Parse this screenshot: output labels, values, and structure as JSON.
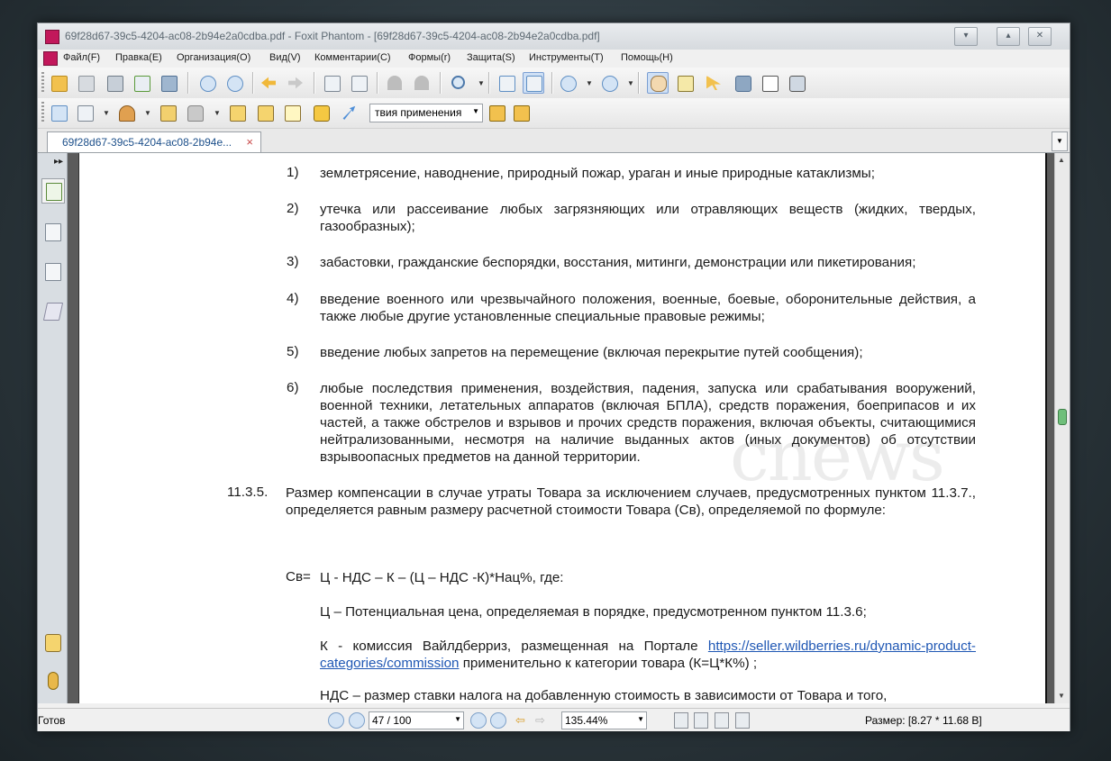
{
  "window": {
    "title": "69f28d67-39c5-4204-ac08-2b94e2a0cdba.pdf - Foxit Phantom - [69f28d67-39c5-4204-ac08-2b94e2a0cdba.pdf]",
    "controls": {
      "minimize": "▾",
      "restore": "▴",
      "close": "✕"
    }
  },
  "menu": [
    "Файл(F)",
    "Правка(E)",
    "Организация(O)",
    "Вид(V)",
    "Комментарии(C)",
    "Формы(r)",
    "Защита(S)",
    "Инструменты(T)",
    "Помощь(H)"
  ],
  "toolbar2": {
    "combo_value": "твия применения"
  },
  "tab": {
    "label": "69f28d67-39c5-4204-ac08-2b94e...",
    "close": "×"
  },
  "document": {
    "watermark": "cnews",
    "items": [
      {
        "num": "1)",
        "text": "землетрясение, наводнение, природный пожар, ураган и иные природные катаклизмы;"
      },
      {
        "num": "2)",
        "text": "утечка или рассеивание любых загрязняющих или отравляющих веществ (жидких, твердых, газообразных);"
      },
      {
        "num": "3)",
        "text": "забастовки, гражданские беспорядки, восстания, митинги, демонстрации или пикетирования;"
      },
      {
        "num": "4)",
        "text": "введение военного или чрезвычайного положения, военные, боевые, оборонительные действия, а также любые другие установленные специальные правовые режимы;"
      },
      {
        "num": "5)",
        "text": "введение любых запретов на перемещение (включая перекрытие путей сообщения);"
      },
      {
        "num": "6)",
        "text": "любые последствия применения, воздействия, падения, запуска или срабатывания вооружений, военной техники, летательных аппаратов (включая БПЛА), средств поражения, боеприпасов и их частей, а также обстрелов и взрывов и прочих средств поражения, включая объекты, считающимися нейтрализованными, несмотря на наличие выданных актов (иных документов) об отсутствии взрывоопасных предметов на данной территории."
      }
    ],
    "clause_num": "11.3.5.",
    "clause_text": "Размер компенсации в случае утраты Товара за исключением случаев, предусмотренных пунктом 11.3.7., определяется равным размеру расчетной стоимости Товара (Св), определяемой по формуле:",
    "formula_label": "Св=",
    "formula": "Ц - НДС – К – (Ц – НДС -К)*Нац%, где:",
    "def_c": "Ц – Потенциальная цена, определяемая в порядке, предусмотренном пунктом 11.3.6;",
    "def_k_before": "К - комиссия Вайлдберриз, размещенная на Портале ",
    "def_k_link": "https://seller.wildberries.ru/dynamic-product-categories/commission",
    "def_k_after": " применительно к категории товара (К=Ц*К%) ;",
    "def_vat": "НДС – размер ставки налога на добавленную стоимость в зависимости от Товара и того,"
  },
  "status": {
    "ready": "Готов",
    "page": "47 / 100",
    "zoom": "135.44%",
    "size": "Размер: [8.27 * 11.68 В]"
  },
  "colors": {
    "link": "#1f57b4",
    "scroll_thumb": "#6fbf7a"
  }
}
